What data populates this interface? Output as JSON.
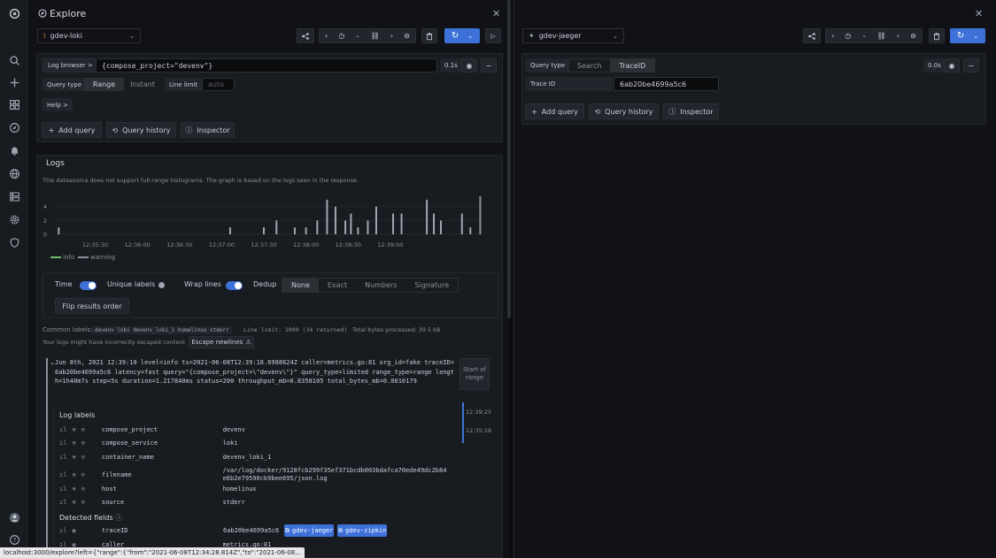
{
  "sidebar": {
    "icons": [
      "grafana-logo-icon",
      "search-icon",
      "plus-icon",
      "dashboards-icon",
      "explore-icon",
      "alert-bell-icon",
      "globe-icon",
      "server-icon",
      "gear-icon",
      "shield-icon",
      "avatar-icon",
      "help-icon"
    ]
  },
  "left": {
    "title": "Explore",
    "datasource": "gdev-loki",
    "log_browser_label": "Log browser >",
    "query": "{compose_project=\"devenv\"}",
    "query_time": "0.1s",
    "query_type_label": "Query type",
    "query_types": [
      "Range",
      "Instant"
    ],
    "line_limit_label": "Line limit",
    "line_limit_placeholder": "auto",
    "help_label": "Help >",
    "add_query": "Add query",
    "query_history": "Query history",
    "inspector": "Inspector"
  },
  "logs": {
    "title": "Logs",
    "notice": "This datasource does not support full-range histograms. The graph is based on the logs seen in the response.",
    "legend": [
      "info",
      "warning"
    ],
    "time_label": "Time",
    "unique_labels": "Unique labels",
    "wrap_lines": "Wrap lines",
    "dedup_label": "Dedup",
    "dedup_options": [
      "None",
      "Exact",
      "Numbers",
      "Signature"
    ],
    "flip_order": "Flip results order",
    "common_labels_label": "Common labels:",
    "common_labels": "devenv loki devenv_loki_1 homelinux stderr",
    "line_limit_info": "Line limit: 1000 (34 returned)",
    "bytes_info": "Total bytes processed: 39.5 kB",
    "escape_notice": "Your logs might have incorrectly escaped content",
    "escape_button": "Escape newlines",
    "log_line": "Jun 8th, 2021 12:39:10 level=info ts=2021-06-08T12:39:18.6988624Z caller=metrics.go:81 org_id=fake traceID=6ab20be4699a5c6 latency=fast query=\"{compose_project=\\\"devenv\\\"}\" query_type=limited range_type=range length=1h40m7s step=5s duration=1.217840ms status=200 throughput_mb=0.8358105 total_bytes_mb=0.0010179",
    "start_of_range": "Start of range",
    "scroll_times": [
      "12:39:25",
      "12:35:16"
    ],
    "log_labels_title": "Log labels",
    "labels": [
      {
        "key": "compose_project",
        "value": "devenv"
      },
      {
        "key": "compose_service",
        "value": "loki"
      },
      {
        "key": "container_name",
        "value": "devenv_loki_1"
      },
      {
        "key": "filename",
        "value": "/var/log/docker/9128fcb299f35ef371bcdb003bdafca70ede49dc2b84e6b2e79590cb9bee695/json.log"
      },
      {
        "key": "host",
        "value": "homelinux"
      },
      {
        "key": "source",
        "value": "stderr"
      }
    ],
    "detected_fields_title": "Detected fields",
    "fields": [
      {
        "key": "traceID",
        "value": "6ab20be4699a5c6"
      },
      {
        "key": "caller",
        "value": "metrics.go:81"
      }
    ],
    "link_jaeger": "gdev-jaeger",
    "link_zipkin": "gdev-zipkin"
  },
  "chart_data": {
    "type": "bar",
    "x_tick_labels": [
      "12:35:30",
      "12:36:00",
      "12:36:30",
      "12:37:00",
      "12:37:30",
      "12:38:00",
      "12:38:30",
      "12:39:00"
    ],
    "x_unit": "seconds after 12:35:00",
    "y_tick_labels": [
      "0",
      "2",
      "4"
    ],
    "ylim": [
      0,
      6
    ],
    "series": [
      {
        "name": "info",
        "color": "#73bf69",
        "x": [
          4,
          126,
          150,
          159,
          172,
          180,
          188,
          195,
          201,
          208,
          212,
          217,
          224,
          230,
          242,
          248,
          266,
          271,
          276,
          291,
          297
        ],
        "values": [
          1,
          1,
          1,
          2,
          1,
          1,
          2,
          5,
          4,
          2,
          3,
          1,
          2,
          4,
          3,
          3,
          5,
          3,
          2,
          3,
          1
        ]
      },
      {
        "name": "warning",
        "color": "#8e8e9b",
        "x": [
          304
        ],
        "values": [
          5.5
        ]
      }
    ]
  },
  "right": {
    "datasource": "gdev-jaeger",
    "query_type_label": "Query type",
    "query_types": [
      "Search",
      "TraceID"
    ],
    "trace_id_label": "Trace ID",
    "trace_id_value": "6ab20be4699a5c6",
    "query_time": "0.0s",
    "add_query": "Add query",
    "query_history": "Query history",
    "inspector": "Inspector"
  },
  "status_url": "localhost:3000/explore?left={\"range\":{\"from\":\"2021-06-08T12:34:28.814Z\",\"to\":\"2021-06-08..."
}
